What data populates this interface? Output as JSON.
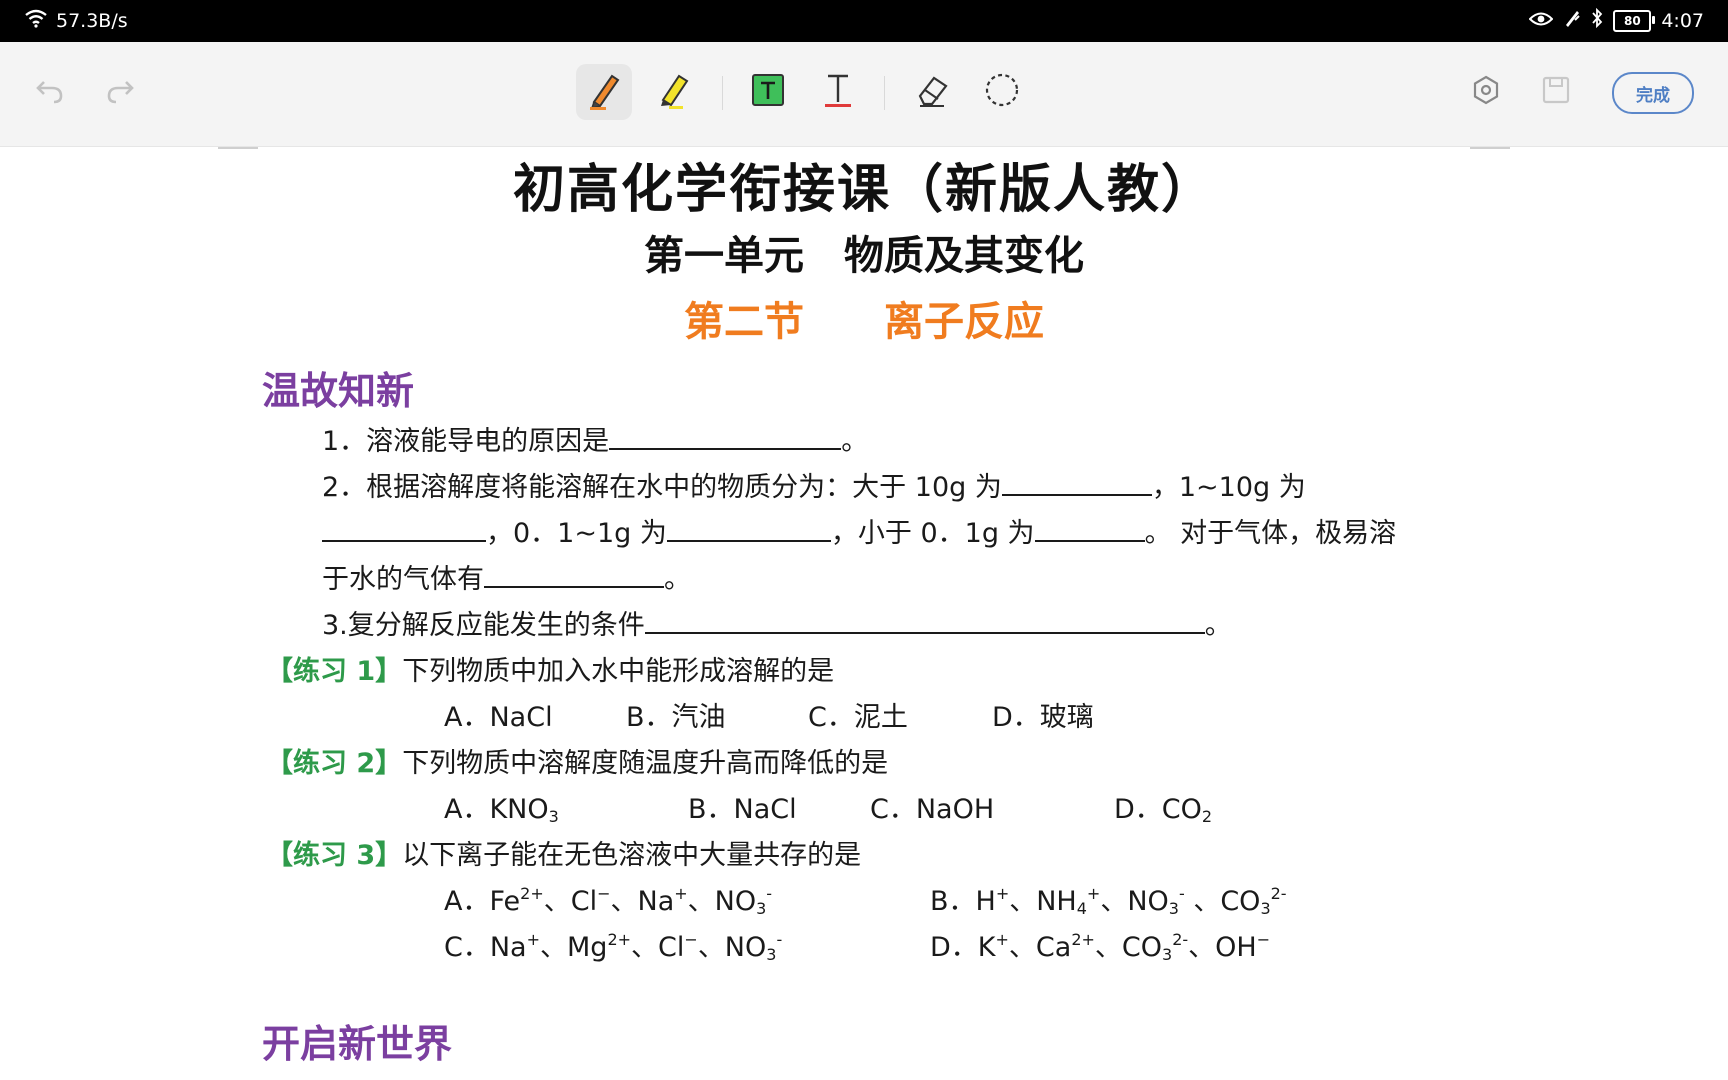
{
  "status_bar": {
    "network_speed": "57.3B/s",
    "battery": "80",
    "time": "4:07"
  },
  "toolbar": {
    "done_label": "完成",
    "tools": [
      "undo-icon",
      "redo-icon",
      "pen-icon",
      "highlighter-icon",
      "textbox-icon",
      "text-cursor-icon",
      "eraser-icon",
      "lasso-icon",
      "settings-icon",
      "save-icon"
    ]
  },
  "doc": {
    "title": "初高化学衔接课（新版人教）",
    "unit": "第一单元　物质及其变化",
    "section_title": "第二节　　离子反应",
    "review_heading": "温故知新",
    "q1_text": "1．溶液能导电的原因是",
    "q1_end": "。",
    "q2_a": "2．根据溶解度将能溶解在水中的物质分为：大于 10g 为",
    "q2_b": "，1~10g 为",
    "q2_c": "，0．1~1g 为",
    "q2_d": "，小于 0．1g 为",
    "q2_e": "。 对于气体，极易溶",
    "q2_f": "于水的气体有",
    "q2_g": "。",
    "q3_text": "3.复分解反应能发生的条件",
    "q3_end": "。",
    "ex1_label": "【练习 1】",
    "ex1_text": "下列物质中加入水中能形成溶解的是",
    "ex1_options": [
      "A．NaCl",
      "B．汽油",
      "C．泥土",
      "D．玻璃"
    ],
    "ex2_label": "【练习 2】",
    "ex2_text": "下列物质中溶解度随温度升高而降低的是",
    "ex2_opt_a": "A．KNO",
    "ex2_opt_a_sub": "3",
    "ex2_opt_b": "B．NaCl",
    "ex2_opt_c": "C．NaOH",
    "ex2_opt_d": "D．CO",
    "ex2_opt_d_sub": "2",
    "ex3_label": "【练习 3】",
    "ex3_text": "以下离子能在无色溶液中大量共存的是",
    "new_heading": "开启新世界"
  },
  "colors": {
    "section_orange": "#f07c1f",
    "heading_purple": "#7b3fa0",
    "exercise_green": "#2e9a4a",
    "done_blue": "#4f7fc4"
  }
}
